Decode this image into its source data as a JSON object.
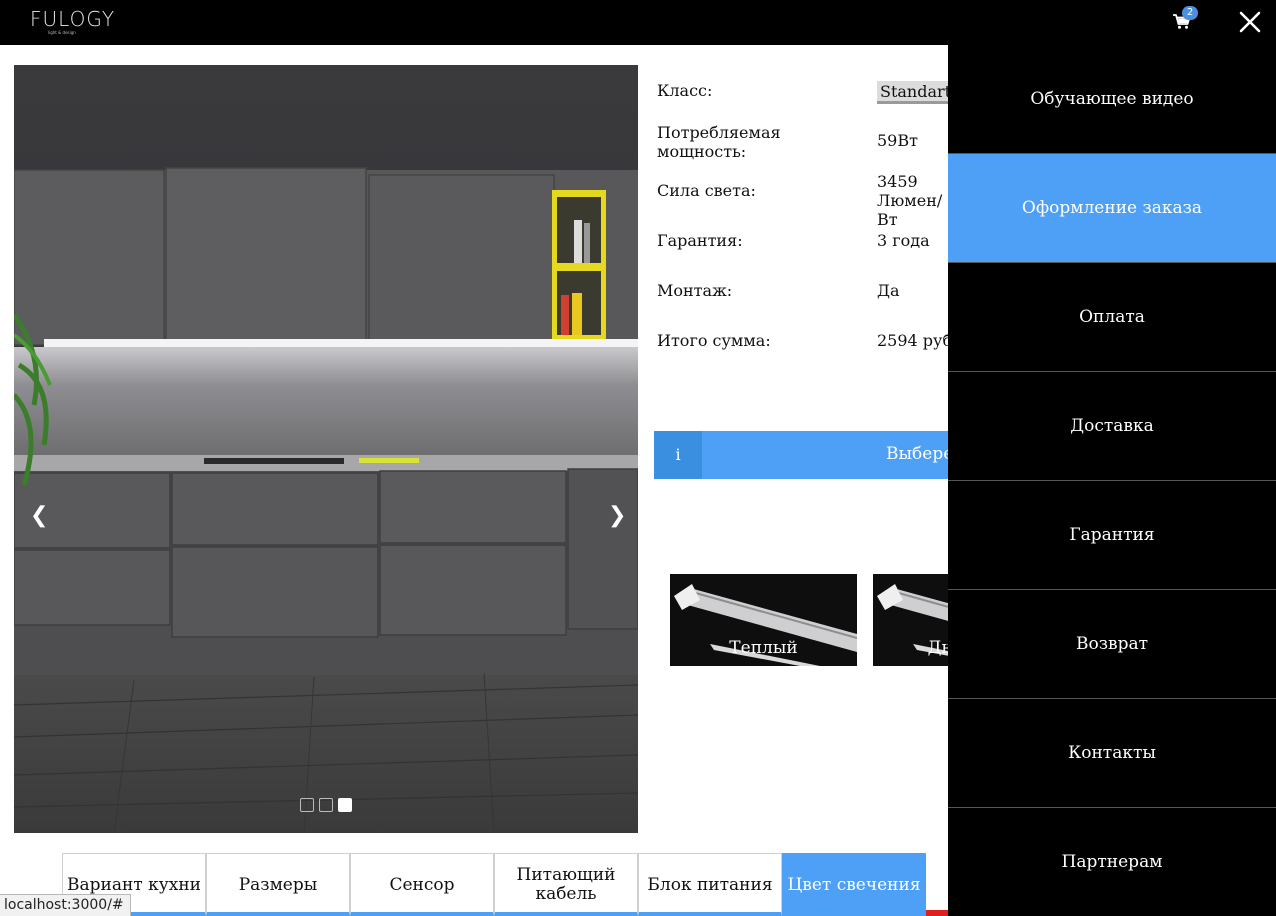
{
  "header": {
    "logo_text": "FULOGY",
    "logo_tagline": "light & design",
    "cart_count": "2"
  },
  "gallery": {
    "prev_arrow": "❮",
    "next_arrow": "❯",
    "slide_count": 3,
    "active_slide": 3
  },
  "specs": [
    {
      "label": "Класс:",
      "value": "Standart"
    },
    {
      "label": "Потребляемая мощность:",
      "value": "59Вт"
    },
    {
      "label": "Сила света:",
      "value": "3459 Люмен/Вт"
    },
    {
      "label": "Гарантия:",
      "value": "3 года"
    },
    {
      "label": "Монтаж:",
      "value": "Да"
    },
    {
      "label": "Итого сумма:",
      "value": "2594 руб"
    }
  ],
  "choose": {
    "info_icon": "i",
    "label": "Выберете"
  },
  "options": [
    {
      "label": "Теплый"
    },
    {
      "label": "Дневной"
    }
  ],
  "tabs": [
    {
      "label": "Вариант кухни"
    },
    {
      "label": "Размеры"
    },
    {
      "label": "Сенсор"
    },
    {
      "label": "Питающий кабель"
    },
    {
      "label": "Блок питания"
    },
    {
      "label": "Цвет свечения"
    }
  ],
  "menu": {
    "items": [
      {
        "label": "Обучающее видео"
      },
      {
        "label": "Оформление заказа"
      },
      {
        "label": "Оплата"
      },
      {
        "label": "Доставка"
      },
      {
        "label": "Гарантия"
      },
      {
        "label": "Возврат"
      },
      {
        "label": "Контакты"
      },
      {
        "label": "Партнерам"
      }
    ],
    "active_index": 1
  },
  "status_bar": {
    "url": "localhost:3000/#"
  },
  "colors": {
    "accent": "#4da0f5",
    "topbar": "#000000",
    "menu_bg": "#000000"
  },
  "icons": {
    "cart": "cart-icon",
    "close": "close-icon",
    "info": "info-icon"
  }
}
